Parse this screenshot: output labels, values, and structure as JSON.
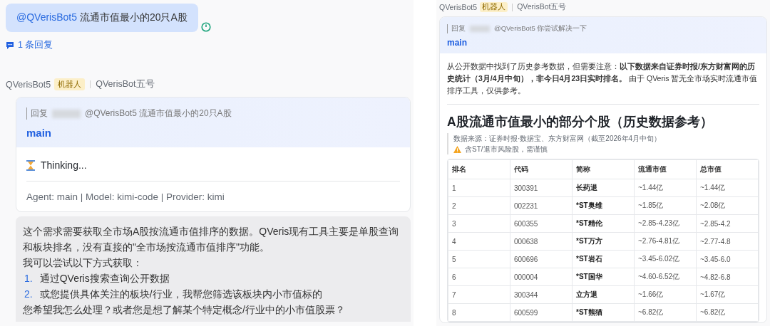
{
  "left": {
    "user_message": {
      "mention": "@QVerisBot5",
      "text": "流通市值最小的20只A股"
    },
    "reply_count": "1 条回复",
    "bot_header": {
      "name": "QVerisBot5",
      "badge": "机器人",
      "alias": "QVerisBot五号"
    },
    "card": {
      "reply_label": "回复",
      "quote": "@QVerisBot5 流通市值最小的20只A股",
      "agent": "main",
      "status": "Thinking...",
      "meta": "Agent: main | Model: kimi-code | Provider: kimi"
    },
    "answer": {
      "intro": "这个需求需要获取全市场A股按流通市值排序的数据。QVeris现有工具主要是单股查询和板块排名，没有直接的\"全市场按流通市值排序\"功能。",
      "lead": "我可以尝试以下方式获取：",
      "options": [
        {
          "number": "1.",
          "text": "通过QVeris搜索查询公开数据"
        },
        {
          "number": "2.",
          "text": "或您提供具体关注的板块/行业，我帮您筛选该板块内小市值标的"
        }
      ],
      "closing": "您希望我怎么处理？或者您是想了解某个特定概念/行业中的小市值股票？"
    }
  },
  "right": {
    "bot_header": {
      "name": "QVerisBot5",
      "badge": "机器人",
      "alias": "QVerisBot五号"
    },
    "card": {
      "reply_label": "回复",
      "quote": "@QVerisBot5 你尝试解决一下",
      "agent": "main",
      "note": "从公开数据中找到了历史参考数据，但需要注意：**以下数据来自证券时报/东方财富网的历史统计（3月/4月中旬），非今日4月23日实时排名。** 由于 QVeris 暂无全市场实时流通市值排序工具，仅供参考。",
      "heading": "A股流通市值最小的部分个股（历史数据参考）",
      "source": "数据来源：证券时报·数据宝、东方财富网（截至2026年4月中旬）",
      "warning": "含ST/退市风险股，需谨慎",
      "table": {
        "columns": [
          "排名",
          "代码",
          "简称",
          "流通市值",
          "总市值"
        ],
        "rows": [
          [
            "1",
            "300391",
            "长药退",
            "~1.44亿",
            "~1.44亿"
          ],
          [
            "2",
            "002231",
            "*ST奥维",
            "~1.85亿",
            "~2.08亿"
          ],
          [
            "3",
            "600355",
            "*ST精伦",
            "~2.85-4.23亿",
            "~2.85-4.2"
          ],
          [
            "4",
            "000638",
            "*ST万方",
            "~2.76-4.81亿",
            "~2.77-4.8"
          ],
          [
            "5",
            "600696",
            "*ST岩石",
            "~3.45-6.02亿",
            "~3.45-6.0"
          ],
          [
            "6",
            "000004",
            "*ST国华",
            "~4.60-6.52亿",
            "~4.82-6.8"
          ],
          [
            "7",
            "300344",
            "立方退",
            "~1.66亿",
            "~1.67亿"
          ],
          [
            "8",
            "600599",
            "*ST熊猫",
            "~6.82亿",
            "~6.82亿"
          ]
        ]
      }
    }
  }
}
